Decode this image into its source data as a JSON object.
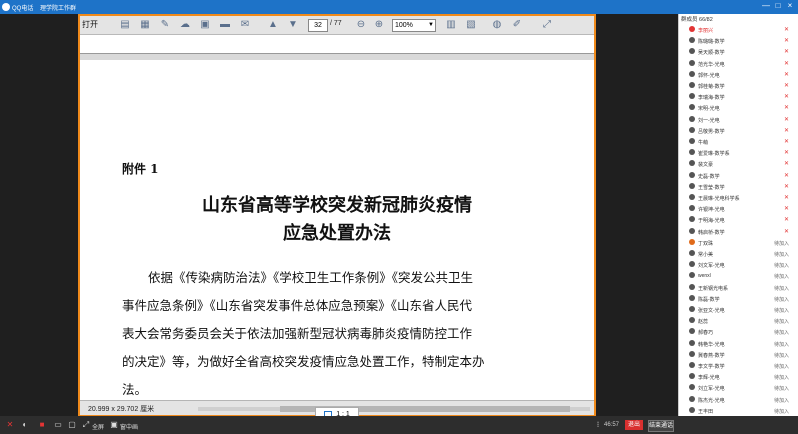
{
  "window": {
    "title": "QQ电话",
    "group": "理学院工作群",
    "controls": [
      "—",
      "□",
      "×"
    ]
  },
  "pdf": {
    "toolbar": {
      "open_label": "打开",
      "page_current": "32",
      "page_total": "/ 77",
      "zoom": "100%"
    },
    "content": {
      "annex": "附件 1",
      "title_line1": "山东省高等学校突发新冠肺炎疫情",
      "title_line2": "应急处置办法",
      "paragraph": [
        "依据《传染病防治法》《学校卫生工作条例》《突发公共卫生",
        "事件应急条例》《山东省突发事件总体应急预案》《山东省人民代",
        "表大会常务委员会关于依法加强新型冠状病毒肺炎疫情防控工作",
        "的决定》等，为做好全省高校突发疫情应急处置工作，特制定本办",
        "法。"
      ]
    },
    "status": {
      "page_size": "20.999 x 29.702 厘米"
    },
    "ratio_label": "1 : 1"
  },
  "bottom": {
    "fullscreen_label": "全屏",
    "view_label": "窗中画",
    "time": "46:57",
    "exit_label": "退出",
    "end_label": "结束通话"
  },
  "sidebar": {
    "header": "群成员 66/82",
    "members": [
      {
        "name": "李丽兴",
        "status": "",
        "muted": true,
        "color": "#e23434"
      },
      {
        "name": "陈璐璐-数学",
        "status": "",
        "muted": true,
        "color": "#555"
      },
      {
        "name": "吴天顺-数学",
        "status": "",
        "muted": true,
        "color": "#555"
      },
      {
        "name": "范光华-光电",
        "status": "",
        "muted": true,
        "color": "#555"
      },
      {
        "name": "郭怀-光电",
        "status": "",
        "muted": true,
        "color": "#555"
      },
      {
        "name": "郭桂菊-数学",
        "status": "",
        "muted": true,
        "color": "#555"
      },
      {
        "name": "李瑞海-数学",
        "status": "",
        "muted": true,
        "color": "#555"
      },
      {
        "name": "宋明-光电",
        "status": "",
        "muted": true,
        "color": "#555"
      },
      {
        "name": "刘一-光电",
        "status": "",
        "muted": true,
        "color": "#555"
      },
      {
        "name": "吕敬男-数学",
        "status": "",
        "muted": true,
        "color": "#555"
      },
      {
        "name": "牛萌",
        "status": "",
        "muted": true,
        "color": "#555"
      },
      {
        "name": "崔爱琳-数学系",
        "status": "",
        "muted": true,
        "color": "#555"
      },
      {
        "name": "裴文豪",
        "status": "",
        "muted": true,
        "color": "#555"
      },
      {
        "name": "史磊-数学",
        "status": "",
        "muted": true,
        "color": "#555"
      },
      {
        "name": "王雪莹-数学",
        "status": "",
        "muted": true,
        "color": "#555"
      },
      {
        "name": "王晨琳-光电科学系",
        "status": "",
        "muted": true,
        "color": "#555"
      },
      {
        "name": "许银坤-光电",
        "status": "",
        "muted": true,
        "color": "#555"
      },
      {
        "name": "于明海-光电",
        "status": "",
        "muted": true,
        "color": "#555"
      },
      {
        "name": "韩启桥-数学",
        "status": "",
        "muted": true,
        "color": "#555"
      },
      {
        "name": "丁双珠",
        "status": "待加入",
        "muted": false,
        "color": "#e06a1a"
      },
      {
        "name": "常小美",
        "status": "待加入",
        "muted": false,
        "color": "#555"
      },
      {
        "name": "刘文军-光电",
        "status": "待加入",
        "muted": false,
        "color": "#555"
      },
      {
        "name": "wenxl",
        "status": "待加入",
        "muted": false,
        "color": "#555"
      },
      {
        "name": "王新钢光电系",
        "status": "待加入",
        "muted": false,
        "color": "#555"
      },
      {
        "name": "陈磊-数学",
        "status": "待加入",
        "muted": false,
        "color": "#555"
      },
      {
        "name": "张亚文-光电",
        "status": "待加入",
        "muted": false,
        "color": "#555"
      },
      {
        "name": "赵蕊",
        "status": "待加入",
        "muted": false,
        "color": "#555"
      },
      {
        "name": "郝春巧",
        "status": "待加入",
        "muted": false,
        "color": "#555"
      },
      {
        "name": "韩艳华-光电",
        "status": "待加入",
        "muted": false,
        "color": "#555"
      },
      {
        "name": "冀春燕-数学",
        "status": "待加入",
        "muted": false,
        "color": "#555"
      },
      {
        "name": "李文学-数学",
        "status": "待加入",
        "muted": false,
        "color": "#555"
      },
      {
        "name": "李辉-光电",
        "status": "待加入",
        "muted": false,
        "color": "#555"
      },
      {
        "name": "刘立军-光电",
        "status": "待加入",
        "muted": false,
        "color": "#555"
      },
      {
        "name": "陈杰光-光电",
        "status": "待加入",
        "muted": false,
        "color": "#555"
      },
      {
        "name": "王丰田",
        "status": "待加入",
        "muted": false,
        "color": "#555"
      }
    ]
  }
}
